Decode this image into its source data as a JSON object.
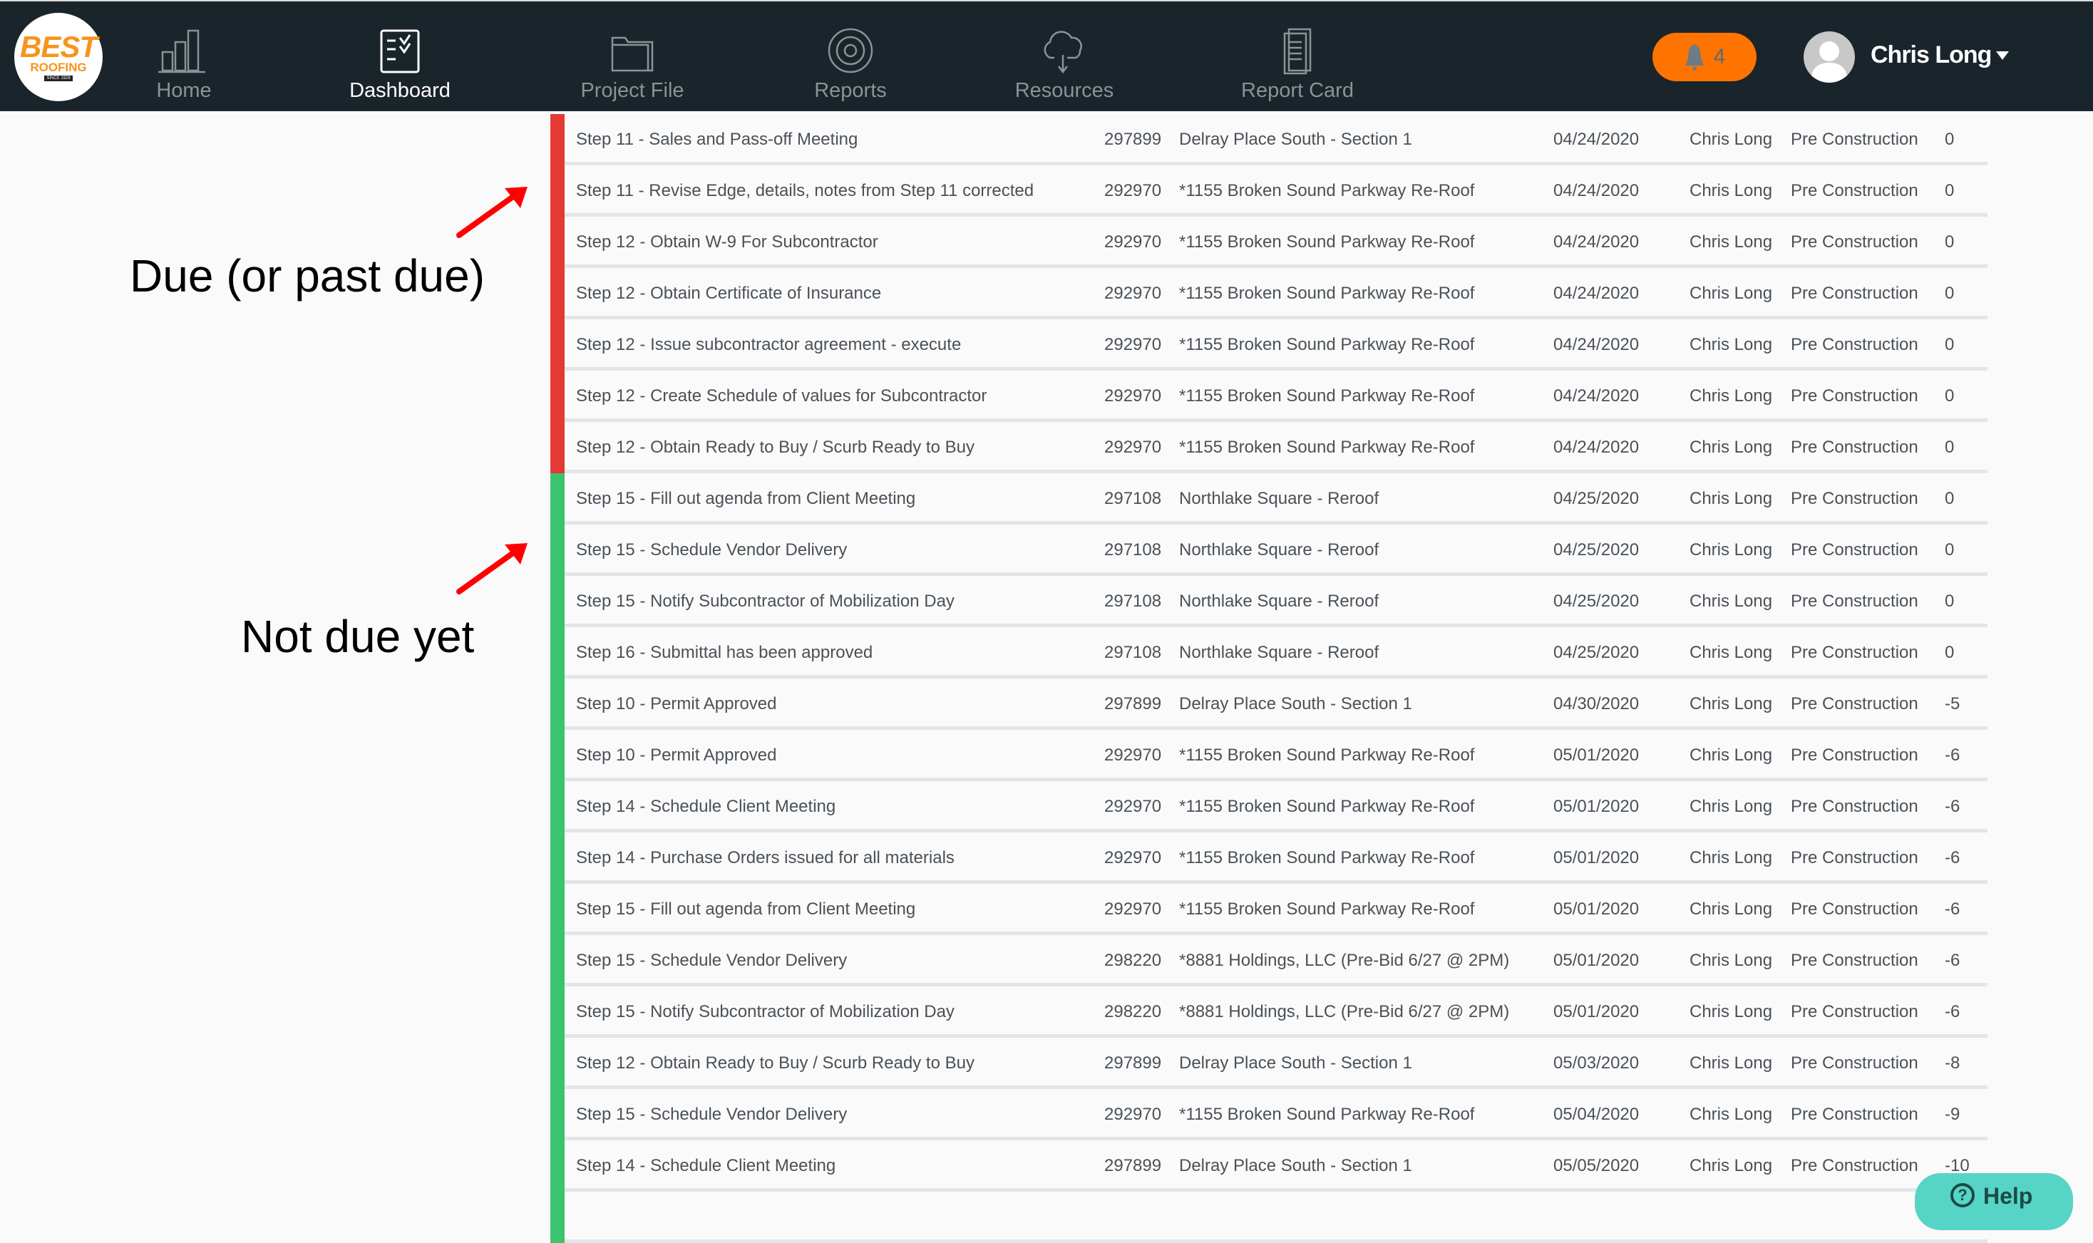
{
  "brand": {
    "line1": "BEST",
    "line2": "ROOFING",
    "line3": "SINCE 1928"
  },
  "nav": [
    {
      "label": "Home",
      "icon": "bar-chart-icon",
      "active": false
    },
    {
      "label": "Dashboard",
      "icon": "checklist-icon",
      "active": true
    },
    {
      "label": "Project File",
      "icon": "folder-icon",
      "active": false
    },
    {
      "label": "Reports",
      "icon": "target-icon",
      "active": false
    },
    {
      "label": "Resources",
      "icon": "cloud-download-icon",
      "active": false
    },
    {
      "label": "Report Card",
      "icon": "document-icon",
      "active": false
    }
  ],
  "notifications": {
    "count": "4",
    "color": "#ff7300"
  },
  "user": {
    "name": "Chris Long"
  },
  "annotations": {
    "due": "Due (or past due)",
    "not_due": "Not due yet",
    "arrow_color": "#ff0000"
  },
  "status_colors": {
    "due": "#e53935",
    "not_due": "#3cc36e"
  },
  "rows": [
    {
      "status": "due",
      "task": "Step 11 - Sales and Pass-off Meeting",
      "number": "297899",
      "project": "Delray Place South - Section 1",
      "date": "04/24/2020",
      "user": "Chris Long",
      "phase": "Pre Construction",
      "days": "0"
    },
    {
      "status": "due",
      "task": "Step 11 - Revise Edge, details, notes from Step 11 corrected",
      "number": "292970",
      "project": "*1155 Broken Sound Parkway Re-Roof",
      "date": "04/24/2020",
      "user": "Chris Long",
      "phase": "Pre Construction",
      "days": "0"
    },
    {
      "status": "due",
      "task": "Step 12 - Obtain W-9 For Subcontractor",
      "number": "292970",
      "project": "*1155 Broken Sound Parkway Re-Roof",
      "date": "04/24/2020",
      "user": "Chris Long",
      "phase": "Pre Construction",
      "days": "0"
    },
    {
      "status": "due",
      "task": "Step 12 - Obtain Certificate of Insurance",
      "number": "292970",
      "project": "*1155 Broken Sound Parkway Re-Roof",
      "date": "04/24/2020",
      "user": "Chris Long",
      "phase": "Pre Construction",
      "days": "0"
    },
    {
      "status": "due",
      "task": "Step 12 - Issue subcontractor agreement - execute",
      "number": "292970",
      "project": "*1155 Broken Sound Parkway Re-Roof",
      "date": "04/24/2020",
      "user": "Chris Long",
      "phase": "Pre Construction",
      "days": "0"
    },
    {
      "status": "due",
      "task": "Step 12 - Create Schedule of values for Subcontractor",
      "number": "292970",
      "project": "*1155 Broken Sound Parkway Re-Roof",
      "date": "04/24/2020",
      "user": "Chris Long",
      "phase": "Pre Construction",
      "days": "0"
    },
    {
      "status": "due",
      "task": "Step 12 - Obtain Ready to Buy / Scurb Ready to Buy",
      "number": "292970",
      "project": "*1155 Broken Sound Parkway Re-Roof",
      "date": "04/24/2020",
      "user": "Chris Long",
      "phase": "Pre Construction",
      "days": "0"
    },
    {
      "status": "not_due",
      "task": "Step 15 - Fill out agenda from Client Meeting",
      "number": "297108",
      "project": "Northlake Square - Reroof",
      "date": "04/25/2020",
      "user": "Chris Long",
      "phase": "Pre Construction",
      "days": "0"
    },
    {
      "status": "not_due",
      "task": "Step 15 - Schedule Vendor Delivery",
      "number": "297108",
      "project": "Northlake Square - Reroof",
      "date": "04/25/2020",
      "user": "Chris Long",
      "phase": "Pre Construction",
      "days": "0"
    },
    {
      "status": "not_due",
      "task": "Step 15 - Notify Subcontractor of Mobilization Day",
      "number": "297108",
      "project": "Northlake Square - Reroof",
      "date": "04/25/2020",
      "user": "Chris Long",
      "phase": "Pre Construction",
      "days": "0"
    },
    {
      "status": "not_due",
      "task": "Step 16 - Submittal has been approved",
      "number": "297108",
      "project": "Northlake Square - Reroof",
      "date": "04/25/2020",
      "user": "Chris Long",
      "phase": "Pre Construction",
      "days": "0"
    },
    {
      "status": "not_due",
      "task": "Step 10 - Permit Approved",
      "number": "297899",
      "project": "Delray Place South - Section 1",
      "date": "04/30/2020",
      "user": "Chris Long",
      "phase": "Pre Construction",
      "days": "-5"
    },
    {
      "status": "not_due",
      "task": "Step 10 - Permit Approved",
      "number": "292970",
      "project": "*1155 Broken Sound Parkway Re-Roof",
      "date": "05/01/2020",
      "user": "Chris Long",
      "phase": "Pre Construction",
      "days": "-6"
    },
    {
      "status": "not_due",
      "task": "Step 14 - Schedule Client Meeting",
      "number": "292970",
      "project": "*1155 Broken Sound Parkway Re-Roof",
      "date": "05/01/2020",
      "user": "Chris Long",
      "phase": "Pre Construction",
      "days": "-6"
    },
    {
      "status": "not_due",
      "task": "Step 14 - Purchase Orders issued for all materials",
      "number": "292970",
      "project": "*1155 Broken Sound Parkway Re-Roof",
      "date": "05/01/2020",
      "user": "Chris Long",
      "phase": "Pre Construction",
      "days": "-6"
    },
    {
      "status": "not_due",
      "task": "Step 15 - Fill out agenda from Client Meeting",
      "number": "292970",
      "project": "*1155 Broken Sound Parkway Re-Roof",
      "date": "05/01/2020",
      "user": "Chris Long",
      "phase": "Pre Construction",
      "days": "-6"
    },
    {
      "status": "not_due",
      "task": "Step 15 - Schedule Vendor Delivery",
      "number": "298220",
      "project": "*8881 Holdings, LLC (Pre-Bid 6/27 @ 2PM)",
      "date": "05/01/2020",
      "user": "Chris Long",
      "phase": "Pre Construction",
      "days": "-6"
    },
    {
      "status": "not_due",
      "task": "Step 15 - Notify Subcontractor of Mobilization Day",
      "number": "298220",
      "project": "*8881 Holdings, LLC (Pre-Bid 6/27 @ 2PM)",
      "date": "05/01/2020",
      "user": "Chris Long",
      "phase": "Pre Construction",
      "days": "-6"
    },
    {
      "status": "not_due",
      "task": "Step 12 - Obtain Ready to Buy / Scurb Ready to Buy",
      "number": "297899",
      "project": "Delray Place South - Section 1",
      "date": "05/03/2020",
      "user": "Chris Long",
      "phase": "Pre Construction",
      "days": "-8"
    },
    {
      "status": "not_due",
      "task": "Step 15 - Schedule Vendor Delivery",
      "number": "292970",
      "project": "*1155 Broken Sound Parkway Re-Roof",
      "date": "05/04/2020",
      "user": "Chris Long",
      "phase": "Pre Construction",
      "days": "-9"
    },
    {
      "status": "not_due",
      "task": "Step 14 - Schedule Client Meeting",
      "number": "297899",
      "project": "Delray Place South - Section 1",
      "date": "05/05/2020",
      "user": "Chris Long",
      "phase": "Pre Construction",
      "days": "-10"
    },
    {
      "status": "not_due",
      "task": "",
      "number": "",
      "project": "",
      "date": "",
      "user": "",
      "phase": "",
      "days": ""
    }
  ],
  "help": {
    "label": "Help"
  }
}
